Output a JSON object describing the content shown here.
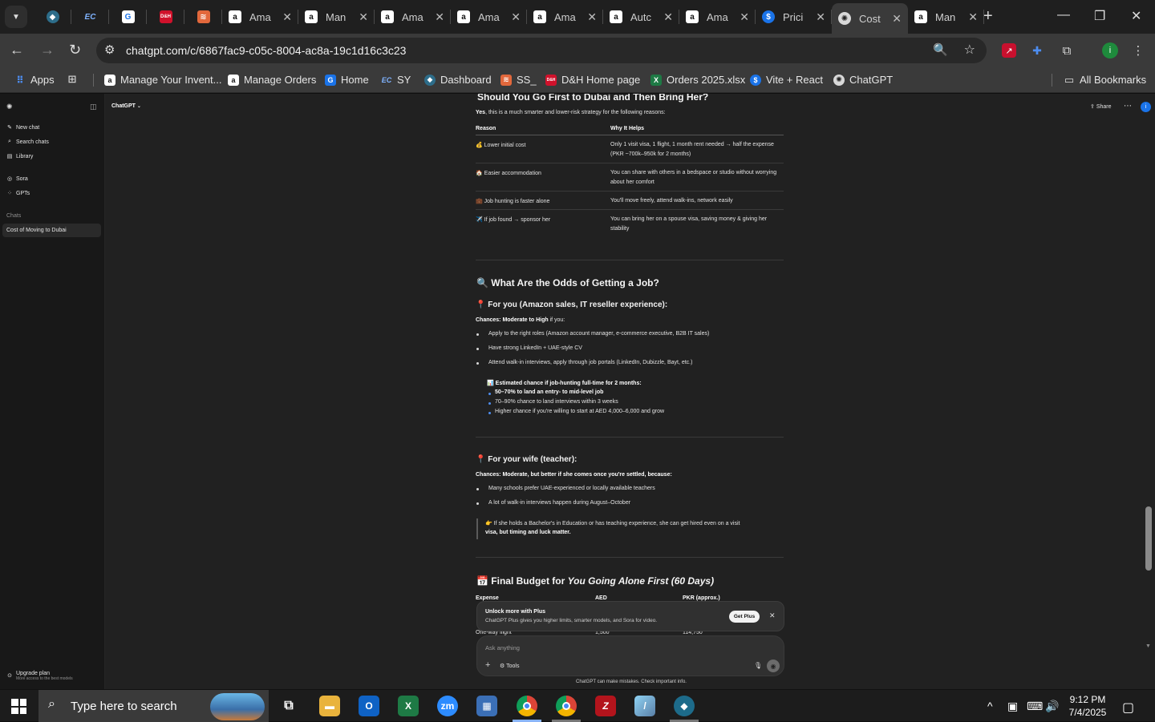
{
  "browser": {
    "tabs": [
      {
        "title": "",
        "icon": "bolt-icon",
        "pinned": true
      },
      {
        "title": "",
        "icon": "ec-icon",
        "pinned": true
      },
      {
        "title": "",
        "icon": "doc-icon",
        "pinned": true
      },
      {
        "title": "",
        "icon": "dh-icon",
        "pinned": true
      },
      {
        "title": "",
        "icon": "stack-icon",
        "pinned": true
      },
      {
        "title": "Ama",
        "icon": "amazon-icon"
      },
      {
        "title": "Man",
        "icon": "amazon-icon"
      },
      {
        "title": "Ama",
        "icon": "amazon-icon"
      },
      {
        "title": "Ama",
        "icon": "amazon-icon"
      },
      {
        "title": "Ama",
        "icon": "amazon-icon"
      },
      {
        "title": "Autc",
        "icon": "amazon-icon"
      },
      {
        "title": "Ama",
        "icon": "amazon-icon"
      },
      {
        "title": "Prici",
        "icon": "dollar-icon"
      },
      {
        "title": "Cost",
        "icon": "chatgpt-icon",
        "active": true
      },
      {
        "title": "Man",
        "icon": "amazon-icon"
      }
    ],
    "url": "chatgpt.com/c/6867fac9-c05c-8004-ac8a-19c1d16c3c23",
    "bookmarks": {
      "apps": "Apps",
      "items": [
        "Manage Your Invent...",
        "Manage Orders",
        "Home",
        "SY",
        "Dashboard",
        "SS_",
        "D&H Home page",
        "Orders 2025.xlsx",
        "Vite + React",
        "ChatGPT"
      ],
      "all": "All Bookmarks"
    }
  },
  "sidebar": {
    "new_chat": "New chat",
    "search_chats": "Search chats",
    "library": "Library",
    "sora": "Sora",
    "gpts": "GPTs",
    "chats_label": "Chats",
    "active_chat": "Cost of Moving to Dubai",
    "upgrade_title": "Upgrade plan",
    "upgrade_sub": "More access to the best models"
  },
  "header": {
    "model": "ChatGPT",
    "share": "Share"
  },
  "content": {
    "top_heading": "Should You Go First to Dubai and Then Bring Her?",
    "intro_yes": "Yes",
    "intro_rest": ", this is a much smarter and lower-risk strategy for the following reasons:",
    "table": {
      "headers": [
        "Reason",
        "Why It Helps"
      ],
      "rows": [
        {
          "reason": "💰 Lower initial cost",
          "why1": "Only 1 visit visa, 1 flight, 1 month rent needed → half the expense",
          "why2": "(PKR ~700k–950k for 2 months)"
        },
        {
          "reason": "🏠 Easier accommodation",
          "why1": "You can share with others in a bedspace or studio without worrying",
          "why2": "about her comfort"
        },
        {
          "reason": "💼 Job hunting is faster alone",
          "why1": "You'll move freely, attend walk-ins, network easily",
          "why2": ""
        },
        {
          "reason": "✈️ If job found → sponsor her",
          "why1": "You can bring her on a spouse visa, saving money & giving her",
          "why2": "stability"
        }
      ]
    },
    "odds_heading_pre": "🔍 What Are the ",
    "odds_heading_bold": "Odds of Getting a Job?",
    "you_heading": "📍 For you (Amazon sales, IT reseller experience):",
    "you_chances_bold": "Chances: Moderate to High",
    "you_chances_rest": " if you:",
    "you_bullets": [
      "Apply to the right roles (Amazon account manager, e-commerce executive, B2B IT sales)",
      "Have strong LinkedIn + UAE-style CV",
      "Attend walk-in interviews, apply through job portals (LinkedIn, Dubizzle, Bayt, etc.)"
    ],
    "estimate_title": "📊 Estimated chance if job-hunting full-time for 2 months:",
    "estimate_bullets": [
      "50–70% to land an entry- to mid-level job",
      "70–90% chance to land interviews within 3 weeks",
      "Higher chance if you're willing to start at AED 4,000–6,000 and grow"
    ],
    "wife_heading": "📍 For your wife (teacher):",
    "wife_chances": "Chances: Moderate, but better if she comes once you're settled, because:",
    "wife_bullets": [
      "Many schools prefer UAE-experienced or locally available teachers",
      "A lot of walk-in interviews happen during August–October"
    ],
    "wife_note1": "👉 If she holds a Bachelor's in Education or has teaching experience, she can get hired even on a visit",
    "wife_note2": "visa, but timing and luck matter.",
    "budget_heading_pre": "📅 Final Budget for ",
    "budget_heading_em": "You Going Alone First (60 Days)",
    "budget_cols": [
      "Expense",
      "AED",
      "PKR (approx.)"
    ],
    "budget_row1": [
      "One-way flight",
      "1,500",
      "114,750"
    ]
  },
  "upsell": {
    "title": "Unlock more with Plus",
    "subtitle": "ChatGPT Plus gives you higher limits, smarter models, and Sora for video.",
    "button": "Get Plus"
  },
  "composer": {
    "placeholder": "Ask anything",
    "tools": "Tools"
  },
  "disclaimer": "ChatGPT can make mistakes. Check important info.",
  "taskbar": {
    "search_placeholder": "Type here to search",
    "time": "9:12 PM",
    "date": "7/4/2025"
  },
  "colors": {
    "accent": "#4d8df0",
    "chrome_bg": "#1f1f1f",
    "chat_bg": "#212121",
    "sidebar_bg": "#181818"
  }
}
